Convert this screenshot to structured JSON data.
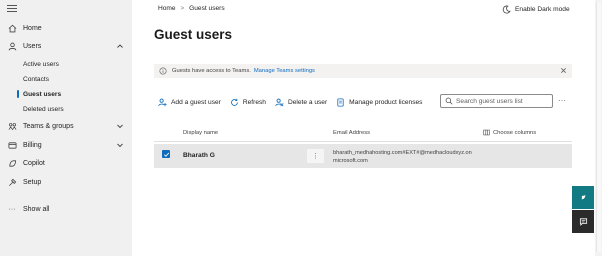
{
  "sidebar": {
    "items": [
      {
        "label": "Home",
        "icon": "home-icon"
      },
      {
        "label": "Users",
        "icon": "user-icon",
        "expanded": true
      },
      {
        "label": "Teams & groups",
        "icon": "teams-icon",
        "expanded": false
      },
      {
        "label": "Billing",
        "icon": "billing-icon",
        "expanded": false
      },
      {
        "label": "Copilot",
        "icon": "copilot-icon"
      },
      {
        "label": "Setup",
        "icon": "setup-icon"
      },
      {
        "label": "Show all",
        "icon": "more-icon"
      }
    ],
    "users_sub": [
      {
        "label": "Active users"
      },
      {
        "label": "Contacts"
      },
      {
        "label": "Guest users",
        "active": true
      },
      {
        "label": "Deleted users"
      }
    ]
  },
  "breadcrumb": {
    "home": "Home",
    "current": "Guest users"
  },
  "header": {
    "dark_mode": "Enable Dark mode",
    "title": "Guest users"
  },
  "info_bar": {
    "text": "Guests have access to Teams.",
    "link": "Manage Teams settings"
  },
  "toolbar": {
    "add": "Add a guest user",
    "refresh": "Refresh",
    "delete": "Delete a user",
    "manage_licenses": "Manage product licenses",
    "search_placeholder": "Search guest users list"
  },
  "table": {
    "columns": {
      "display_name": "Display name",
      "email": "Email Address",
      "choose": "Choose columns"
    },
    "rows": [
      {
        "name": "Bharath G",
        "email_line1": "bharath_medhahosting.com#EXT#@medhacloudxyz.on",
        "email_line2": "microsoft.com",
        "selected": true
      }
    ]
  },
  "colors": {
    "accent": "#0f6cbd",
    "teal": "#127a82",
    "sidebar_bg": "#f0f0f0",
    "selected_row": "#e6e6e6"
  }
}
